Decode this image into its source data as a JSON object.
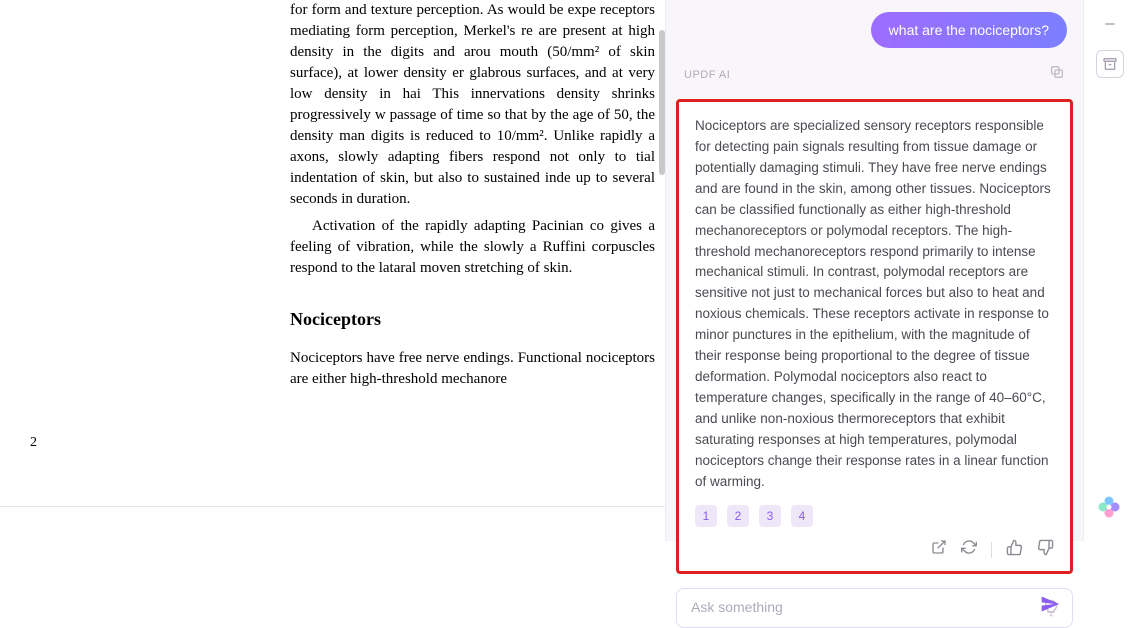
{
  "document": {
    "paragraphs": [
      "for form and texture perception. As would be expe receptors mediating form perception, Merkel's re are present at high density in the digits and arou mouth (50/mm² of skin surface), at lower density er glabrous surfaces, and at very low density in hai This innervations density shrinks progressively w passage of time so that by the age of 50, the density man digits is reduced to 10/mm². Unlike rapidly a axons, slowly adapting fibers respond not only to tial indentation of skin, but also to sustained inde up to several seconds in duration.",
      "Activation of the rapidly adapting Pacinian co gives a feeling of vibration, while the slowly a Ruffini corpuscles respond to the lataral moven stretching of skin."
    ],
    "heading": "Nociceptors",
    "section_text": "Nociceptors have free nerve endings. Functional nociceptors are either high-threshold mechanore",
    "page_number": "2"
  },
  "chat": {
    "user_message": "what are the nociceptors?",
    "ai_label": "UPDF AI",
    "ai_response": "Nociceptors are specialized sensory receptors responsible for detecting pain signals resulting from tissue damage or potentially damaging stimuli. They have free nerve endings and are found in the skin, among other tissues. Nociceptors can be classified functionally as either high-threshold mechanoreceptors or polymodal receptors. The high-threshold mechanoreceptors respond primarily to intense mechanical stimuli. In contrast, polymodal receptors are sensitive not just to mechanical forces but also to heat and noxious chemicals. These receptors activate in response to minor punctures in the epithelium, with the magnitude of their response being proportional to the degree of tissue deformation. Polymodal nociceptors also react to temperature changes, specifically in the range of 40–60°C, and unlike non-noxious thermoreceptors that exhibit saturating responses at high temperatures, polymodal nociceptors change their response rates in a linear function of warming.",
    "references": [
      "1",
      "2",
      "3",
      "4"
    ],
    "input_placeholder": "Ask something"
  },
  "icons": {
    "copy": "copy",
    "open": "open-external",
    "refresh": "refresh",
    "thumbs_up": "thumbs-up",
    "thumbs_down": "thumbs-down",
    "bulb": "lightbulb",
    "send": "send",
    "minus": "minimize",
    "archive": "archive"
  }
}
